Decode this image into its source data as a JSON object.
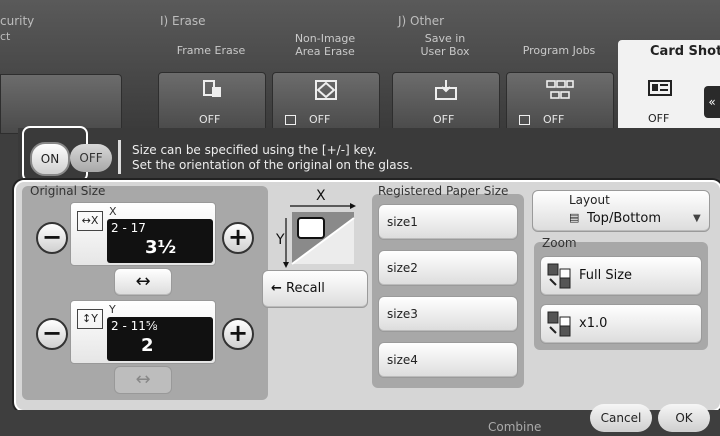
{
  "tabs_bar": {
    "section_left_partial": "curity",
    "left_partial_label": "ct",
    "section_i": "I)  Erase",
    "section_j": "J)  Other",
    "functions": [
      {
        "label_line1": "Frame Erase",
        "label_line2": "",
        "state": "OFF",
        "icon": "frame-erase-icon"
      },
      {
        "label_line1": "Non-Image",
        "label_line2": "Area Erase",
        "state": "OFF",
        "icon": "non-image-area-erase-icon"
      },
      {
        "label_line1": "Save in",
        "label_line2": "User Box",
        "state": "OFF",
        "icon": "save-user-box-icon"
      },
      {
        "label_line1": "Program Jobs",
        "label_line2": "",
        "state": "OFF",
        "icon": "program-jobs-icon"
      }
    ],
    "card_shot": {
      "label": "Card Shot",
      "state": "OFF"
    }
  },
  "message_bar": {
    "on_label": "ON",
    "off_label": "OFF",
    "line1": "Size can be specified using the [+/-] key.",
    "line2": "Set the orientation of the original on the glass."
  },
  "original_size": {
    "title": "Original Size",
    "x": {
      "axis": "X",
      "range": "2 - 17",
      "value": "3½"
    },
    "y": {
      "axis": "Y",
      "range": "2 - 11⅝",
      "value": "2"
    },
    "swap_symbol": "↔",
    "x_axis_label": "X",
    "y_axis_label": "Y",
    "recall_label": "Recall"
  },
  "registered_paper_size": {
    "title": "Registered Paper Size",
    "sizes": [
      "size1",
      "size2",
      "size3",
      "size4"
    ]
  },
  "layout": {
    "title": "Layout",
    "value": "Top/Bottom"
  },
  "zoom": {
    "title": "Zoom",
    "options": [
      "Full Size",
      "x1.0"
    ]
  },
  "footer": {
    "combine_label": "Combine",
    "cancel_label": "Cancel",
    "ok_label": "OK"
  }
}
